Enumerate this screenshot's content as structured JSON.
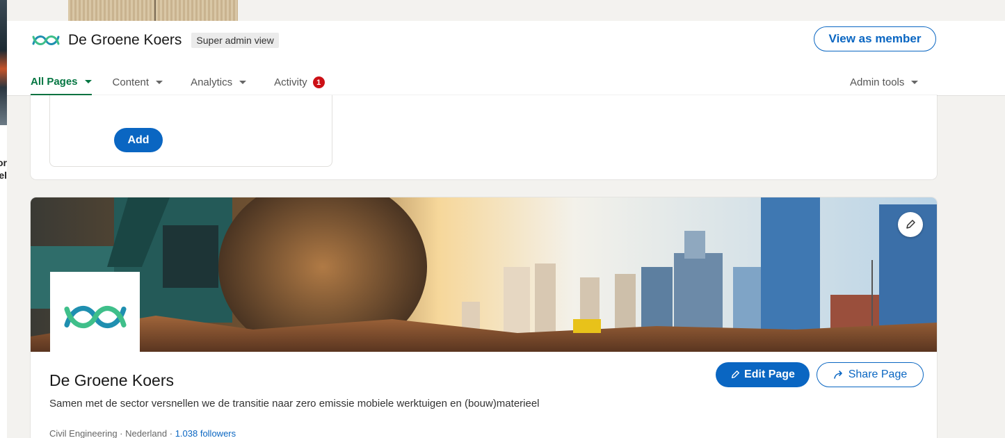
{
  "background": {
    "left_fragments": [
      "or",
      "el"
    ]
  },
  "header": {
    "brand_name": "De Groene Koers",
    "badge": "Super admin view",
    "view_as_member": "View as member",
    "tabs": [
      {
        "label": "All Pages",
        "active": true
      },
      {
        "label": "Content"
      },
      {
        "label": "Analytics"
      },
      {
        "label": "Activity",
        "notification_count": "1"
      }
    ],
    "admin_tools": "Admin tools"
  },
  "upper_card": {
    "add_label": "Add"
  },
  "page": {
    "title": "De Groene Koers",
    "tagline": "Samen met de sector versnellen we de transitie naar zero emissie mobiele werktuigen en (bouw)materieel",
    "industry": "Civil Engineering",
    "location": "Nederland",
    "followers": "1.038 followers",
    "edit_page": "Edit Page",
    "share_page": "Share Page"
  },
  "colors": {
    "accent": "#0a66c2",
    "nav_active": "#057642",
    "notification": "#cc1016",
    "logo_teal": "#1f8fb0",
    "logo_green": "#3fbf8a"
  }
}
